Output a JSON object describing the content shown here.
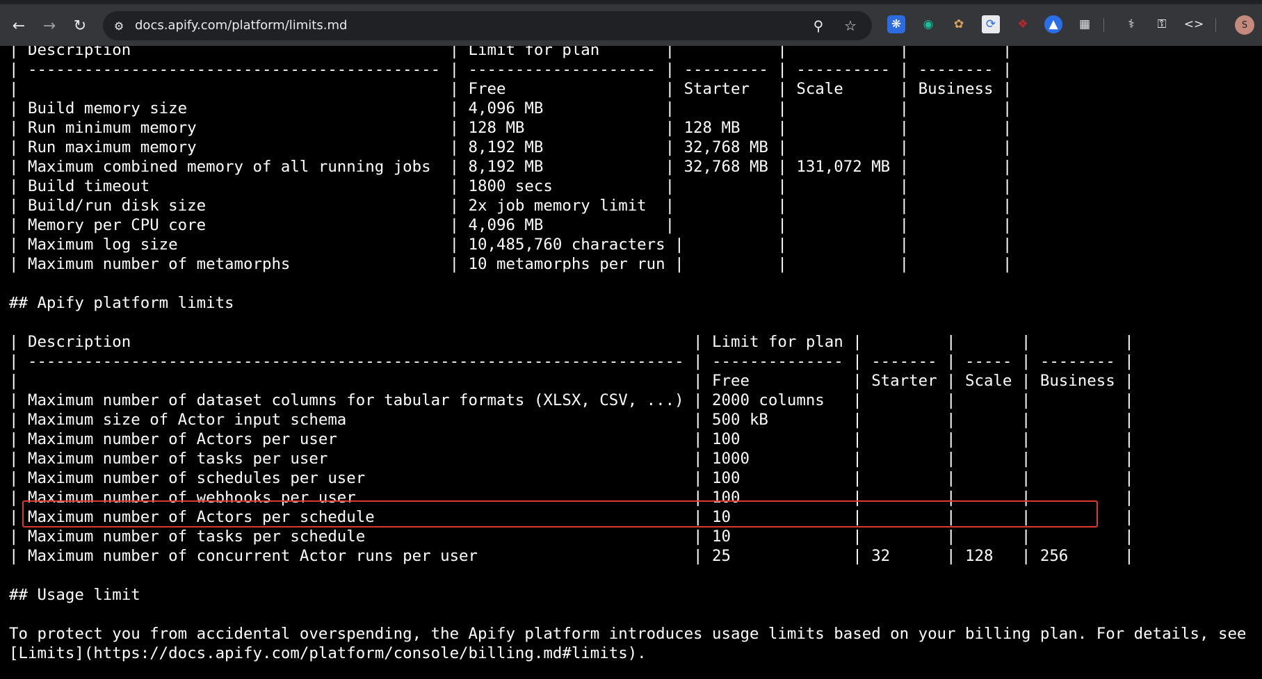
{
  "browser": {
    "url": "docs.apify.com/platform/limits.md",
    "avatar_initial": "S"
  },
  "document": {
    "lines": [
      "| Description                                  | Limit for plan       |           |            |          |",
      "| -------------------------------------------- | -------------------- | --------- | ---------- | -------- |",
      "|                                              | Free                 | Starter   | Scale      | Business |",
      "| Build memory size                            | 4,096 MB             |           |            |          |",
      "| Run minimum memory                           | 128 MB               | 128 MB    |            |          |",
      "| Run maximum memory                           | 8,192 MB             | 32,768 MB |            |          |",
      "| Maximum combined memory of all running jobs  | 8,192 MB             | 32,768 MB | 131,072 MB |          |",
      "| Build timeout                                | 1800 secs            |           |            |          |",
      "| Build/run disk size                          | 2x job memory limit  |           |            |          |",
      "| Memory per CPU core                          | 4,096 MB             |           |            |          |",
      "| Maximum log size                             | 10,485,760 characters |          |            |          |",
      "| Maximum number of metamorphs                 | 10 metamorphs per run |          |            |          |",
      "",
      "## Apify platform limits",
      "",
      "| Description                                                            | Limit for plan |         |       |          |",
      "| ---------------------------------------------------------------------- | -------------- | ------- | ----- | -------- |",
      "|                                                                        | Free           | Starter | Scale | Business |",
      "| Maximum number of dataset columns for tabular formats (XLSX, CSV, ...) | 2000 columns   |         |       |          |",
      "| Maximum size of Actor input schema                                     | 500 kB         |         |       |          |",
      "| Maximum number of Actors per user                                      | 100            |         |       |          |",
      "| Maximum number of tasks per user                                       | 1000           |         |       |          |",
      "| Maximum number of schedules per user                                   | 100            |         |       |          |",
      "| Maximum number of webhooks per user                                    | 100            |         |       |          |",
      "| Maximum number of Actors per schedule                                  | 10             |         |       |          |",
      "| Maximum number of tasks per schedule                                   | 10             |         |       |          |",
      "| Maximum number of concurrent Actor runs per user                       | 25             | 32      | 128   | 256      |",
      "",
      "## Usage limit",
      "",
      "To protect you from accidental overspending, the Apify platform introduces usage limits based on your billing plan. For details, see",
      "[Limits](https://docs.apify.com/platform/console/billing.md#limits)."
    ]
  }
}
